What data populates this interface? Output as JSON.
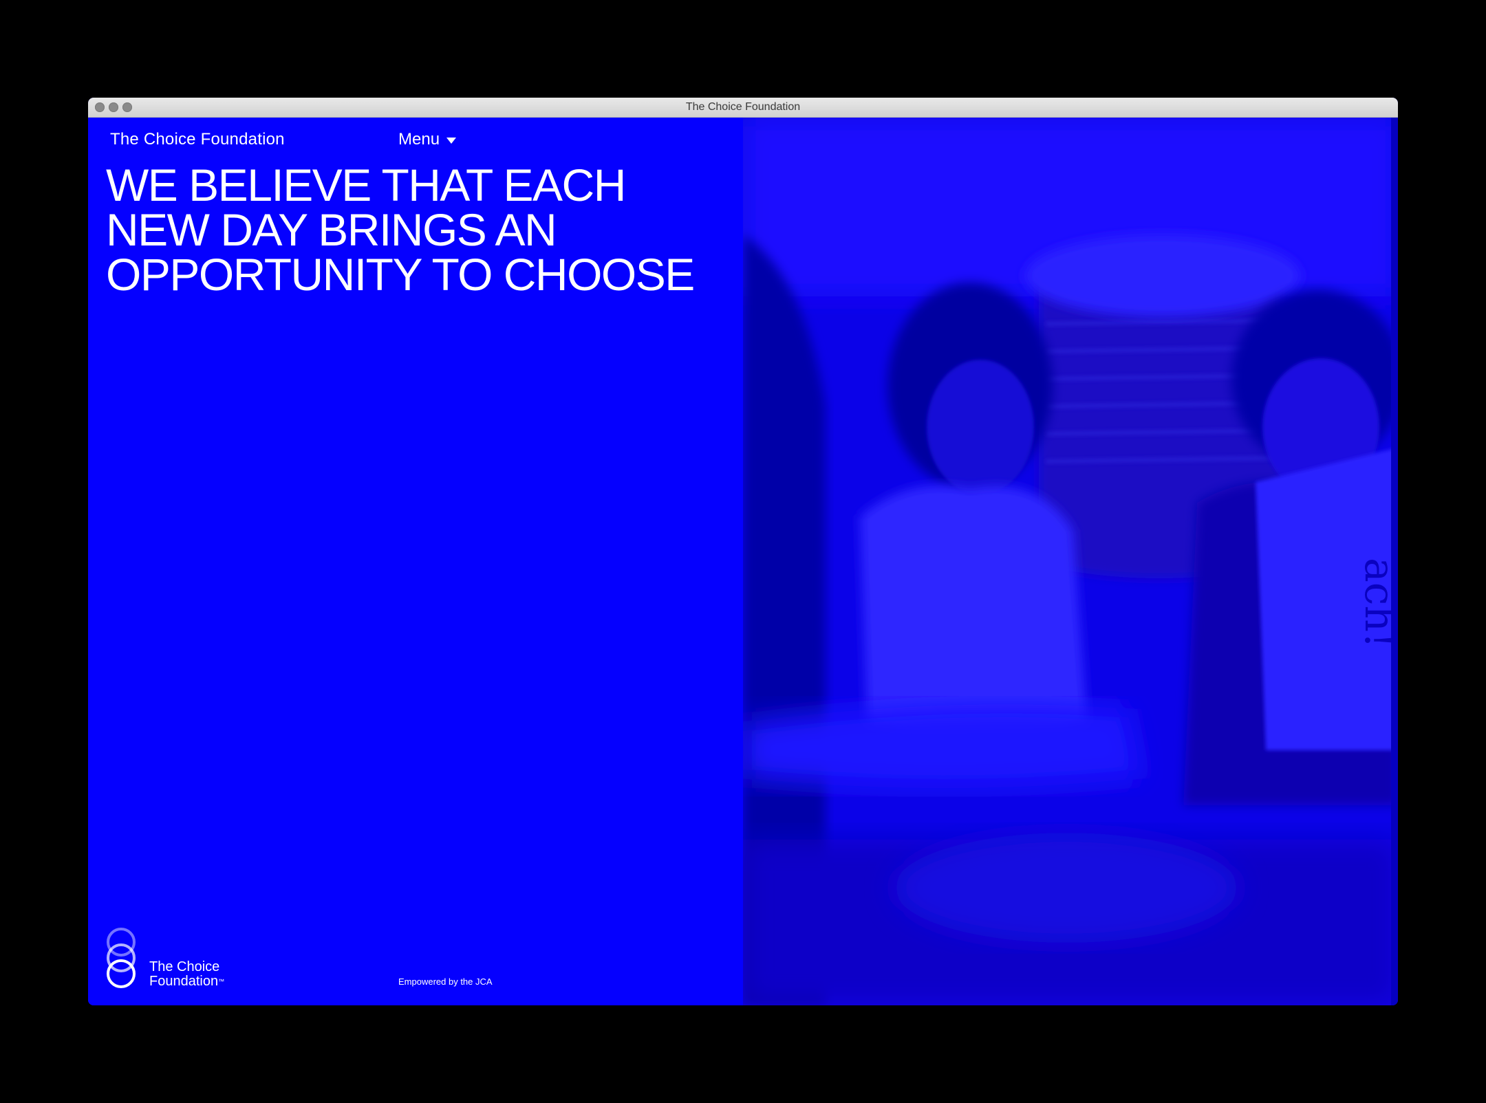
{
  "window": {
    "title": "The Choice Foundation"
  },
  "header": {
    "brand": "The Choice Foundation",
    "menu_label": "Menu"
  },
  "hero": {
    "lines": [
      "WE BELIEVE THAT EACH",
      "NEW DAY BRINGS AN",
      "OPPORTUNITY TO CHOOSE"
    ]
  },
  "footer": {
    "logo_line1": "The Choice",
    "logo_line2": "Foundation",
    "logo_tm": "™",
    "empowered": "Empowered by the JCA"
  },
  "photo": {
    "book_text": "ach!"
  },
  "colors": {
    "brand_blue": "#0500ff",
    "text": "#ffffff"
  }
}
